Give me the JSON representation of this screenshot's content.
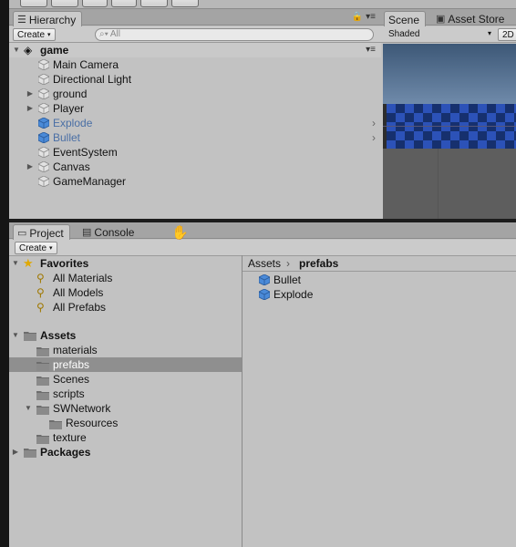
{
  "hierarchy": {
    "tab_label": "Hierarchy",
    "create_label": "Create",
    "search_placeholder": "All",
    "scene_name": "game",
    "items": [
      {
        "label": "Main Camera",
        "expandable": false,
        "prefab": false
      },
      {
        "label": "Directional Light",
        "expandable": false,
        "prefab": false
      },
      {
        "label": "ground",
        "expandable": true,
        "prefab": false
      },
      {
        "label": "Player",
        "expandable": true,
        "prefab": false
      },
      {
        "label": "Explode",
        "expandable": false,
        "prefab": true
      },
      {
        "label": "Bullet",
        "expandable": false,
        "prefab": true
      },
      {
        "label": "EventSystem",
        "expandable": false,
        "prefab": false
      },
      {
        "label": "Canvas",
        "expandable": true,
        "prefab": false
      },
      {
        "label": "GameManager",
        "expandable": false,
        "prefab": false
      }
    ]
  },
  "scene": {
    "tabs": [
      {
        "label": "Scene"
      },
      {
        "label": "Asset Store"
      }
    ],
    "shading_mode": "Shaded",
    "mode_2d": "2D"
  },
  "project": {
    "tabs": [
      {
        "label": "Project"
      },
      {
        "label": "Console"
      }
    ],
    "create_label": "Create",
    "favorites": {
      "label": "Favorites",
      "items": [
        "All Materials",
        "All Models",
        "All Prefabs"
      ]
    },
    "assets": {
      "label": "Assets",
      "folders": [
        "materials",
        "prefabs",
        "Scenes",
        "scripts",
        "SWNetwork",
        "Resources",
        "texture"
      ],
      "selected": "prefabs"
    },
    "packages_label": "Packages",
    "breadcrumb": {
      "root": "Assets",
      "current": "prefabs"
    },
    "files": [
      "Bullet",
      "Explode"
    ]
  },
  "colors": {
    "panel_bg": "#c2c2c2",
    "selection": "#8f8f8f",
    "prefab_text": "#4a6fa5",
    "cube_blue": "#4a8ad8"
  }
}
